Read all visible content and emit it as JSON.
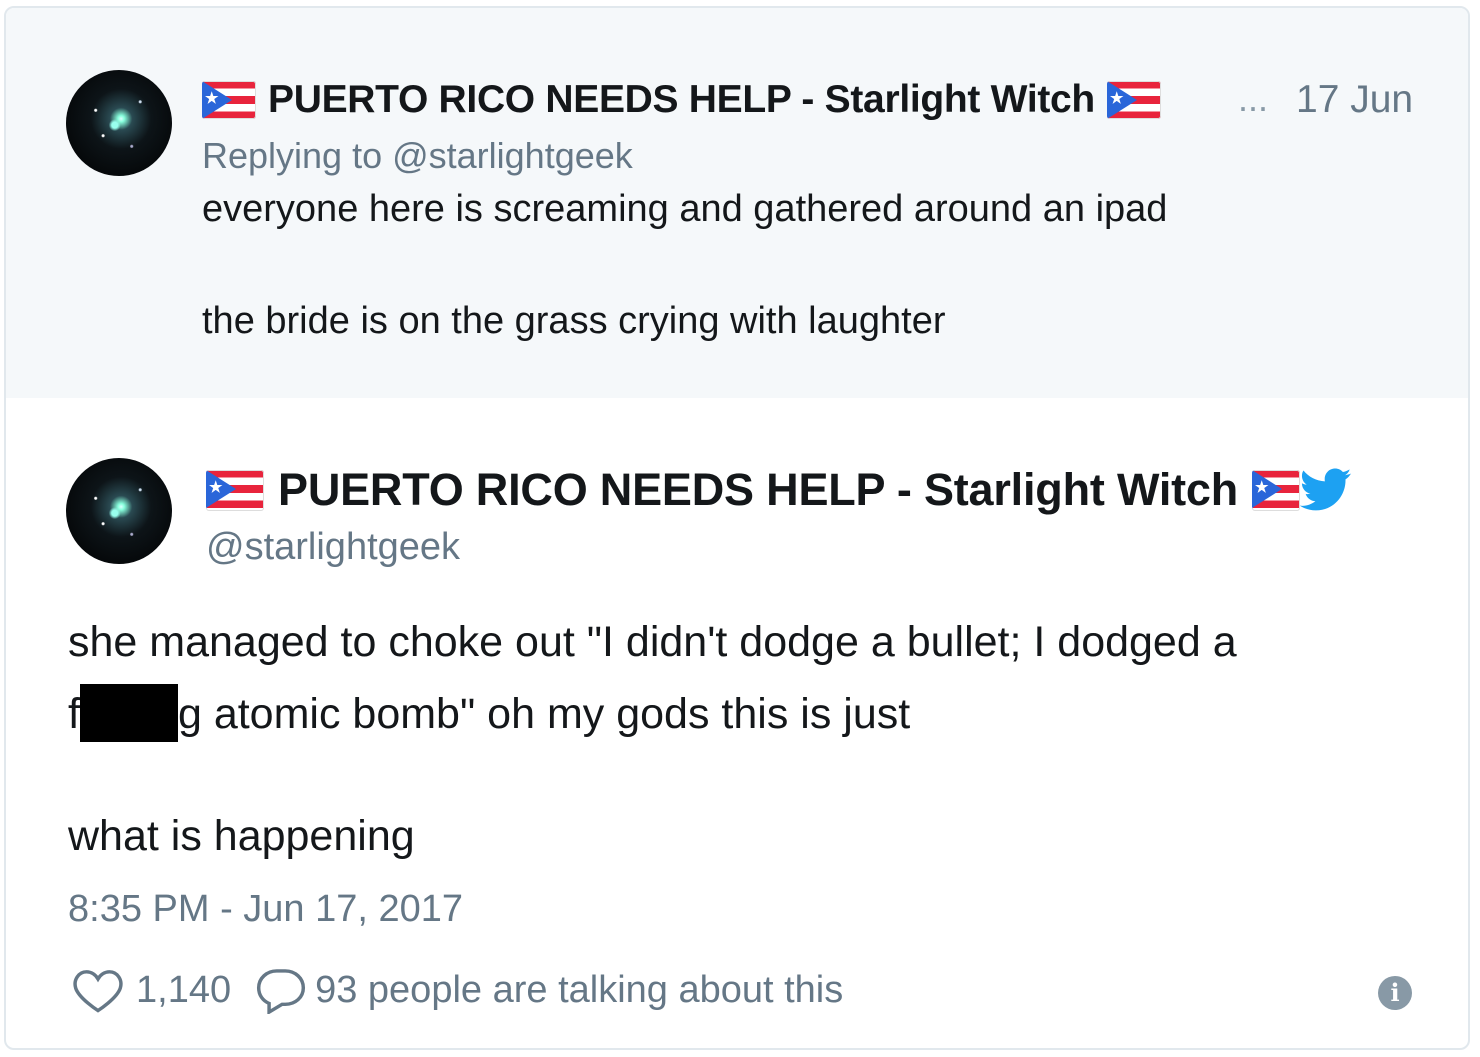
{
  "parent_tweet": {
    "display_name": "PUERTO RICO NEEDS HELP - Starlight Witch",
    "more_dots": "...",
    "date": "17 Jun",
    "replying_to": "Replying to @starlightgeek",
    "line1": "everyone here is screaming and gathered around an ipad",
    "line2": "the bride is on the grass crying with laughter"
  },
  "main_tweet": {
    "display_name": "PUERTO RICO NEEDS HELP - Starlight Witch",
    "handle": "@starlightgeek",
    "line1": "she managed to choke out \"I didn't dodge a bullet; I dodged a",
    "line2_start": "f",
    "line2_end": "g atomic bomb\" oh my gods this is just",
    "line3": "what is happening",
    "timestamp": "8:35 PM - Jun 17, 2017",
    "likes": "1,140",
    "replies_text": "93 people are talking about this"
  },
  "colors": {
    "parent_bg": "#f5f8fa",
    "secondary_text": "#657786",
    "twitter_blue": "#1da1f2",
    "flag_red": "#e8243c",
    "flag_blue": "#2a66d9"
  },
  "icons": [
    "puerto-rico-flag-icon",
    "twitter-bird-icon",
    "heart-icon",
    "speech-bubble-icon",
    "info-icon"
  ]
}
